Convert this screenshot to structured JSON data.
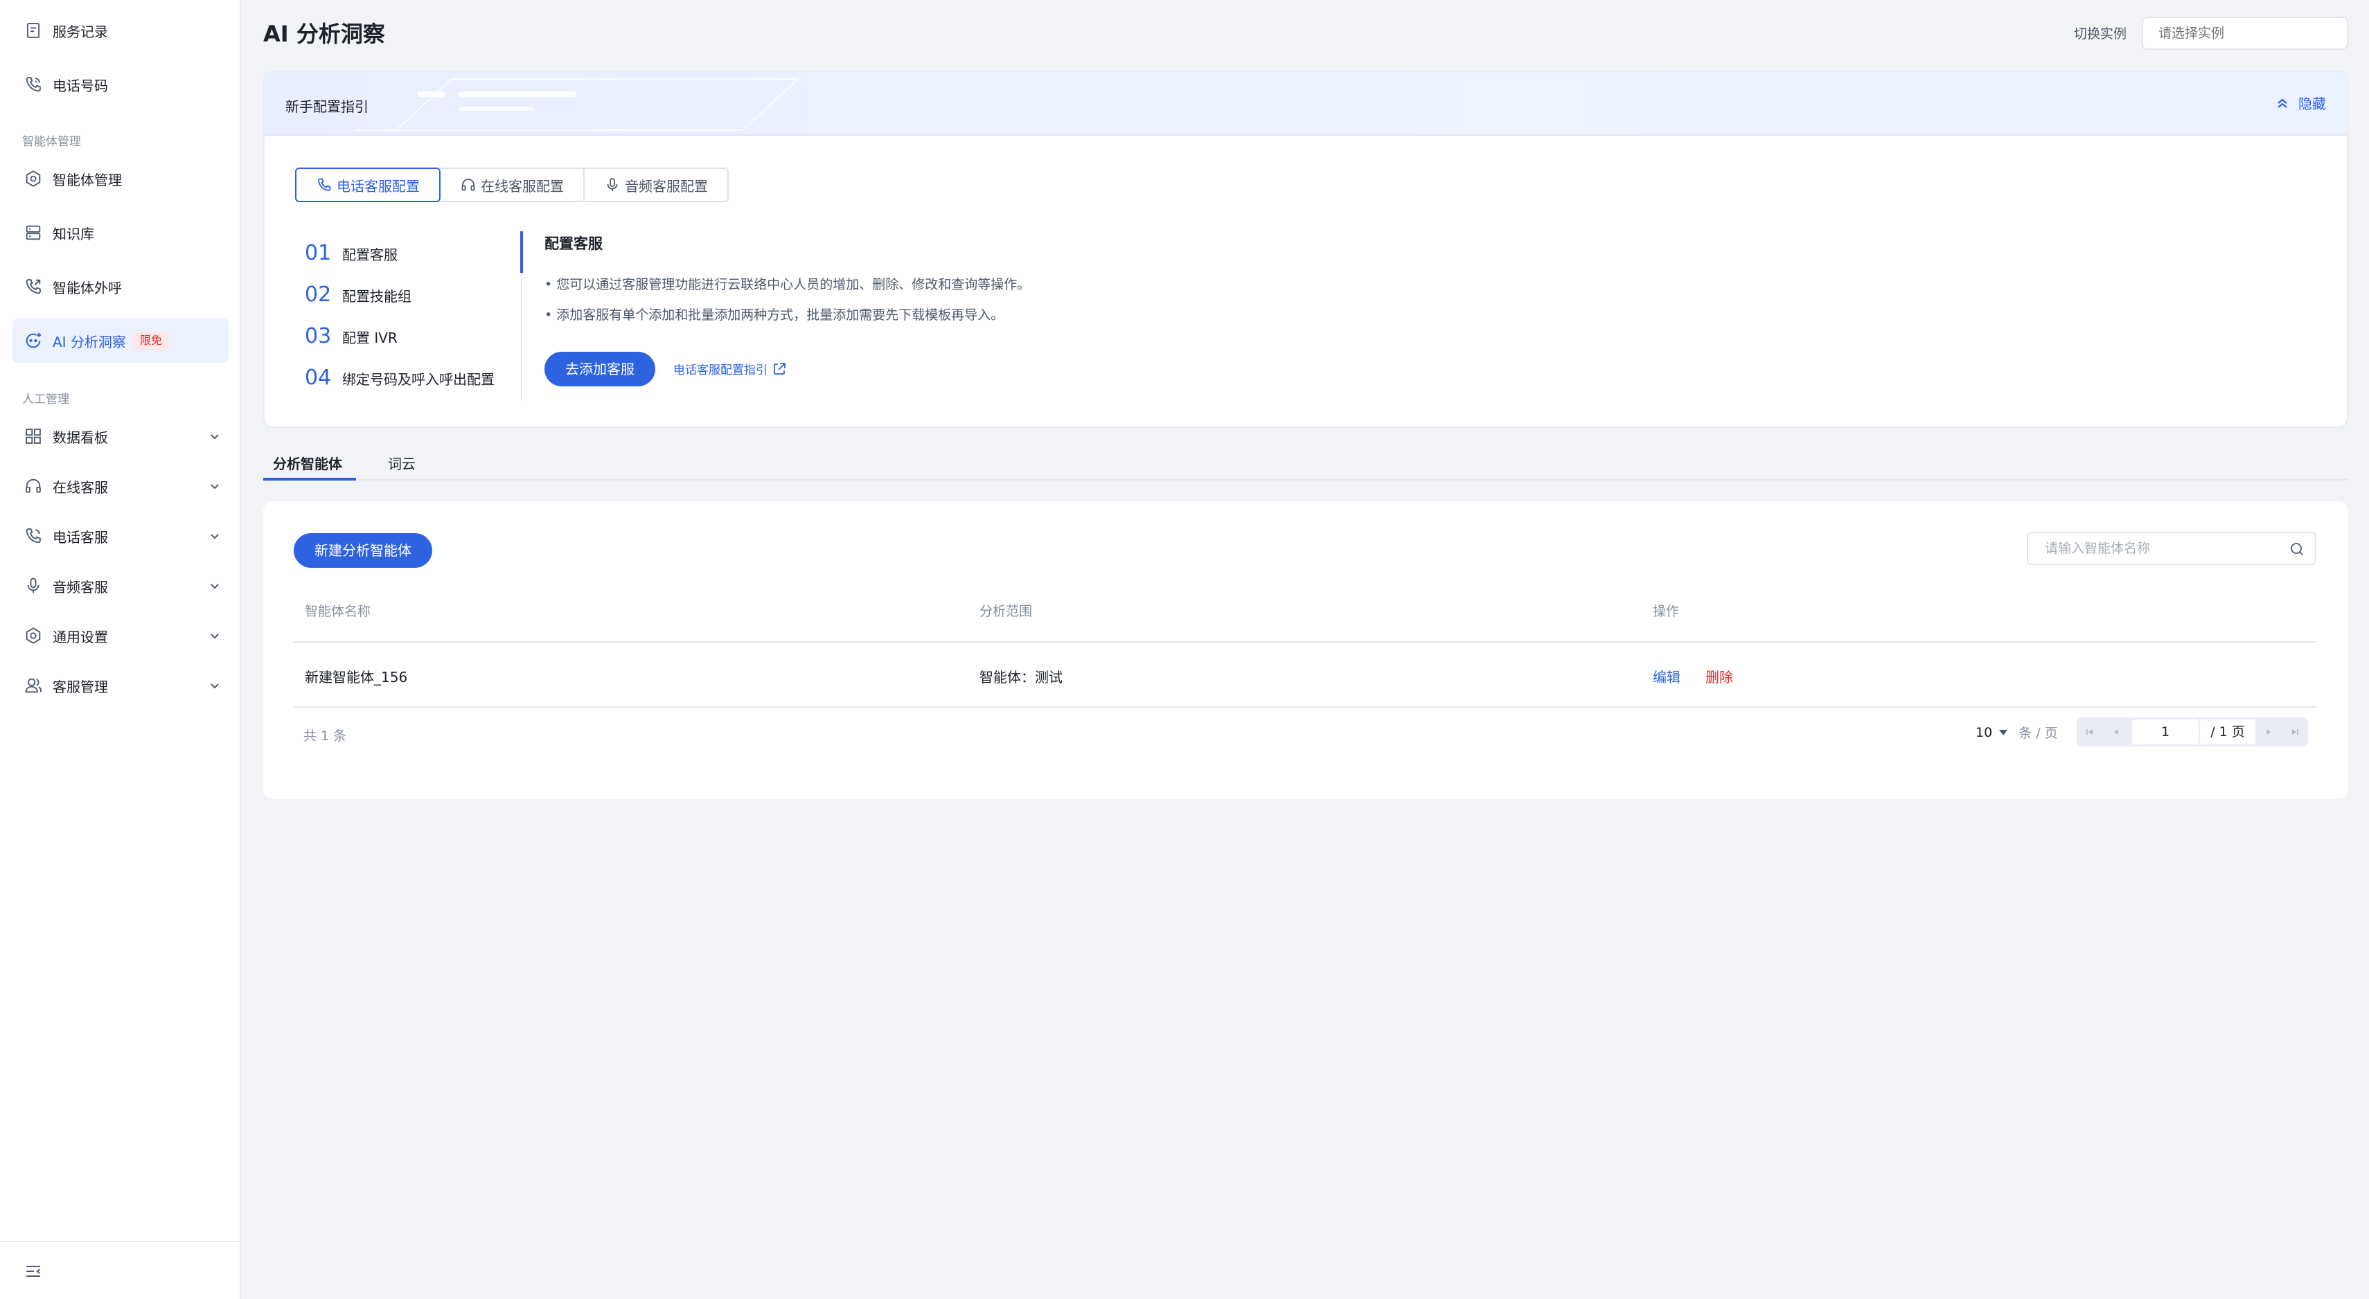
{
  "sidebar": {
    "top_items": [
      {
        "label": "服务记录",
        "icon": "document-icon"
      },
      {
        "label": "电话号码",
        "icon": "phone-icon"
      }
    ],
    "group_agent": "智能体管理",
    "agent_items": [
      {
        "label": "智能体管理",
        "icon": "agent-hexagon-icon"
      },
      {
        "label": "知识库",
        "icon": "database-icon"
      },
      {
        "label": "智能体外呼",
        "icon": "phone-outgoing-icon"
      },
      {
        "label": "AI 分析洞察",
        "icon": "ai-insight-icon",
        "badge": "限免",
        "active": true
      }
    ],
    "group_manual": "人工管理",
    "manual_items": [
      {
        "label": "数据看板",
        "icon": "grid-dashboard-icon"
      },
      {
        "label": "在线客服",
        "icon": "headset-icon"
      },
      {
        "label": "电话客服",
        "icon": "phone-icon"
      },
      {
        "label": "音频客服",
        "icon": "microphone-icon"
      },
      {
        "label": "通用设置",
        "icon": "gear-icon"
      },
      {
        "label": "客服管理",
        "icon": "users-icon"
      }
    ]
  },
  "header": {
    "title": "AI 分析洞察",
    "instance_label": "切换实例",
    "instance_placeholder": "请选择实例"
  },
  "guide": {
    "title": "新手配置指引",
    "hide_label": "隐藏",
    "tabs": [
      {
        "label": "电话客服配置",
        "icon": "phone-icon",
        "active": true
      },
      {
        "label": "在线客服配置",
        "icon": "headset-icon"
      },
      {
        "label": "音频客服配置",
        "icon": "microphone-icon"
      }
    ],
    "steps": [
      {
        "num": "01",
        "label": "配置客服"
      },
      {
        "num": "02",
        "label": "配置技能组"
      },
      {
        "num": "03",
        "label": "配置 IVR"
      },
      {
        "num": "04",
        "label": "绑定号码及呼入呼出配置"
      }
    ],
    "detail_title": "配置客服",
    "bullets": [
      "• 您可以通过客服管理功能进行云联络中心人员的增加、删除、修改和查询等操作。",
      "• 添加客服有单个添加和批量添加两种方式，批量添加需要先下载模板再导入。"
    ],
    "action_button": "去添加客服",
    "doc_link": "电话客服配置指引"
  },
  "tabs": [
    {
      "label": "分析智能体",
      "active": true
    },
    {
      "label": "词云"
    }
  ],
  "list": {
    "create_button": "新建分析智能体",
    "search_placeholder": "请输入智能体名称",
    "columns": [
      "智能体名称",
      "分析范围",
      "操作"
    ],
    "rows": [
      {
        "name": "新建智能体_156",
        "scope": "智能体：测试",
        "edit": "编辑",
        "delete": "删除"
      }
    ],
    "total": "共 1 条",
    "page_size": "10",
    "page_size_unit": "条 / 页",
    "current_page": "1",
    "total_pages": "/ 1 页"
  },
  "colors": {
    "accent": "#2d62e0",
    "danger": "#e22c2c",
    "background": "#f2f3f7"
  }
}
